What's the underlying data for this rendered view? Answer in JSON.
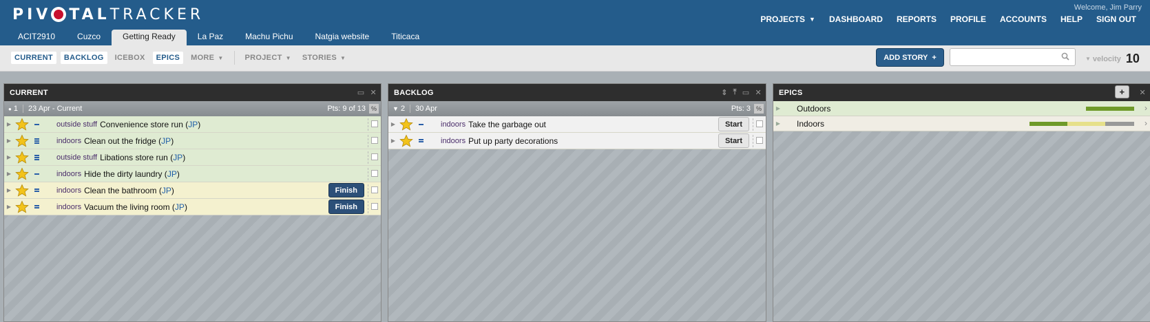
{
  "header": {
    "logo_a": "PIV",
    "logo_b": "TAL",
    "logo_c": "TRACKER",
    "welcome": "Welcome, Jim Parry",
    "nav": [
      "PROJECTS",
      "DASHBOARD",
      "REPORTS",
      "PROFILE",
      "ACCOUNTS",
      "HELP",
      "SIGN OUT"
    ],
    "project_tabs": [
      "ACIT2910",
      "Cuzco",
      "Getting Ready",
      "La Paz",
      "Machu Pichu",
      "Natgia website",
      "Titicaca"
    ],
    "active_tab": "Getting Ready"
  },
  "toolbar": {
    "panels": [
      "CURRENT",
      "BACKLOG",
      "ICEBOX",
      "EPICS"
    ],
    "more": "MORE",
    "project": "PROJECT",
    "stories": "STORIES",
    "add_story": "ADD STORY",
    "add_icon": "+",
    "search_placeholder": "",
    "velocity_label": "velocity",
    "velocity_value": "10"
  },
  "current": {
    "title": "CURRENT",
    "iteration_num": "1",
    "iteration_label": "23 Apr - Current",
    "points": "Pts: 9 of 13",
    "pct": "%",
    "stories": [
      {
        "label": "outside stuff",
        "title": "Convenience store run",
        "owner": "JP",
        "state": "done",
        "est": 1,
        "button": ""
      },
      {
        "label": "indoors",
        "title": "Clean out the fridge",
        "owner": "JP",
        "state": "done",
        "est": 3,
        "button": ""
      },
      {
        "label": "outside stuff",
        "title": "Libations store run",
        "owner": "JP",
        "state": "done",
        "est": 3,
        "button": ""
      },
      {
        "label": "indoors",
        "title": "Hide the dirty laundry",
        "owner": "JP",
        "state": "done",
        "est": 0,
        "button": ""
      },
      {
        "label": "indoors",
        "title": "Clean the bathroom",
        "owner": "JP",
        "state": "started",
        "est": 2,
        "button": "Finish"
      },
      {
        "label": "indoors",
        "title": "Vacuum the living room",
        "owner": "JP",
        "state": "started",
        "est": 2,
        "button": "Finish"
      }
    ]
  },
  "backlog": {
    "title": "BACKLOG",
    "iteration_num": "2",
    "iteration_label": "30 Apr",
    "points": "Pts: 3",
    "pct": "%",
    "stories": [
      {
        "label": "indoors",
        "title": "Take the garbage out",
        "state": "unstarted",
        "est": 0,
        "button": "Start"
      },
      {
        "label": "indoors",
        "title": "Put up party decorations",
        "state": "unstarted",
        "est": 2,
        "button": "Start"
      }
    ]
  },
  "epics": {
    "title": "EPICS",
    "add_icon": "+",
    "items": [
      {
        "name": "Outdoors",
        "done_fraction": 1.0
      },
      {
        "name": "Indoors",
        "done_fraction": 0.36,
        "started_fraction": 0.36
      }
    ]
  },
  "colors": {
    "header_bg": "#245c8b",
    "done_row": "#dfebd2",
    "started_row": "#f4f1cf",
    "finish_btn": "#2c4f78",
    "label_text": "#4a2d6a",
    "owner_link": "#1f5fa8"
  }
}
